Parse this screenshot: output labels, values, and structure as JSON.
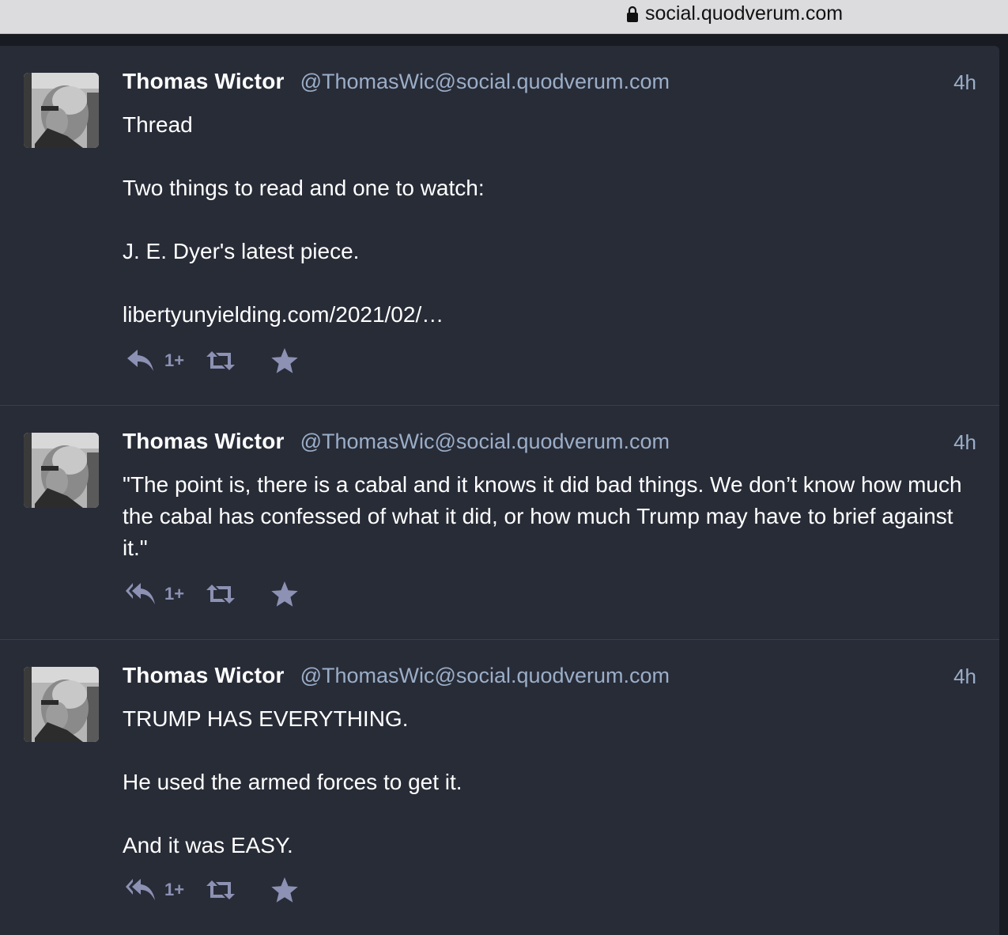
{
  "browser": {
    "url": "social.quodverum.com"
  },
  "colors": {
    "background": "#282c37",
    "accent": "#9baec8",
    "icon": "#8d91b3",
    "text": "#ffffff"
  },
  "statuses": [
    {
      "display_name": "Thomas Wictor",
      "acct": "@ThomasWic@social.quodverum.com",
      "time": "4h",
      "paragraphs": [
        "Thread",
        "Two things to read and one to watch:",
        "J. E. Dyer's latest piece."
      ],
      "link": "libertyunyielding.com/2021/02/…",
      "reply_icon": "reply-icon",
      "reply_count": "1+"
    },
    {
      "display_name": "Thomas Wictor",
      "acct": "@ThomasWic@social.quodverum.com",
      "time": "4h",
      "paragraphs": [
        "\"The point is, there is a cabal and it knows it did bad things.  We don’t know how much the cabal has confessed of what it did, or how much Trump may have to brief against it.\""
      ],
      "reply_icon": "reply-all-icon",
      "reply_count": "1+"
    },
    {
      "display_name": "Thomas Wictor",
      "acct": "@ThomasWic@social.quodverum.com",
      "time": "4h",
      "paragraphs": [
        "TRUMP HAS EVERYTHING.",
        "He used the armed forces to get it.",
        "And it was EASY."
      ],
      "reply_icon": "reply-all-icon",
      "reply_count": "1+"
    }
  ]
}
